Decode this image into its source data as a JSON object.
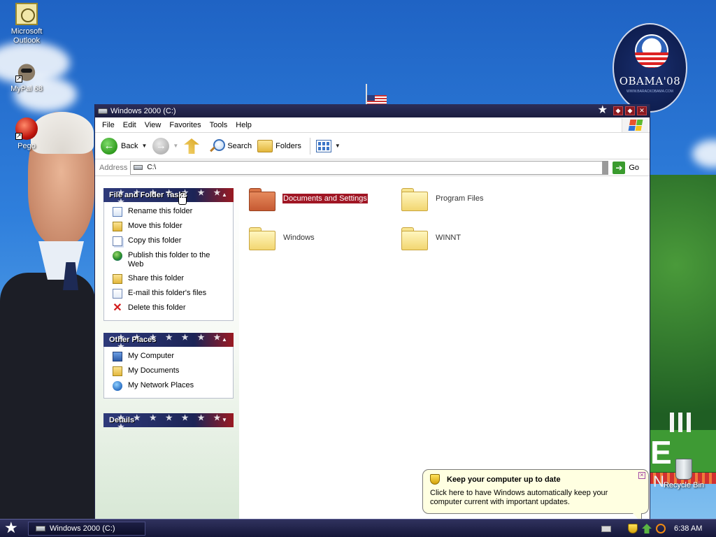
{
  "desktop": {
    "icons": [
      {
        "label": "Microsoft Outlook",
        "icon": "outlook-icon"
      },
      {
        "label": "MyPal 68",
        "icon": "mypal-icon"
      },
      {
        "label": "Pego",
        "icon": "pego-icon"
      }
    ],
    "recycle_bin": "Recycle Bin",
    "logo_text": "OBAMA'08",
    "logo_sub": "WWW.BARACKOBAMA.COM"
  },
  "window": {
    "title": "Windows 2000 (C:)",
    "menu": [
      "File",
      "Edit",
      "View",
      "Favorites",
      "Tools",
      "Help"
    ],
    "toolbar": {
      "back": "Back",
      "search": "Search",
      "folders": "Folders"
    },
    "address": {
      "label": "Address",
      "value": "C:\\",
      "go": "Go"
    },
    "task_pane": {
      "file_folder_tasks": {
        "title": "File and Folder Tasks",
        "items": [
          {
            "label": "Rename this folder",
            "icon": "rename-icon"
          },
          {
            "label": "Move this folder",
            "icon": "move-icon"
          },
          {
            "label": "Copy this folder",
            "icon": "copy-icon"
          },
          {
            "label": "Publish this folder to the Web",
            "icon": "publish-icon"
          },
          {
            "label": "Share this folder",
            "icon": "share-icon"
          },
          {
            "label": "E-mail this folder's files",
            "icon": "email-icon"
          },
          {
            "label": "Delete this folder",
            "icon": "delete-icon"
          }
        ]
      },
      "other_places": {
        "title": "Other Places",
        "items": [
          {
            "label": "My Computer",
            "icon": "my-computer-icon"
          },
          {
            "label": "My Documents",
            "icon": "my-documents-icon"
          },
          {
            "label": "My Network Places",
            "icon": "network-places-icon"
          }
        ]
      },
      "details": {
        "title": "Details"
      }
    },
    "files": [
      {
        "name": "Documents and Settings",
        "selected": true
      },
      {
        "name": "Program Files",
        "selected": false
      },
      {
        "name": "Windows",
        "selected": false
      },
      {
        "name": "WINNT",
        "selected": false
      }
    ]
  },
  "taskbar": {
    "task_button": "Windows 2000 (C:)",
    "clock": "6:38 AM"
  },
  "balloon": {
    "title": "Keep your computer up to date",
    "body": "Click here to have Windows automatically keep your computer current with important updates."
  },
  "colors": {
    "accent_red": "#a01624",
    "titlebar_navy": "#1b1d3f",
    "balloon_bg": "#ffffe1"
  }
}
